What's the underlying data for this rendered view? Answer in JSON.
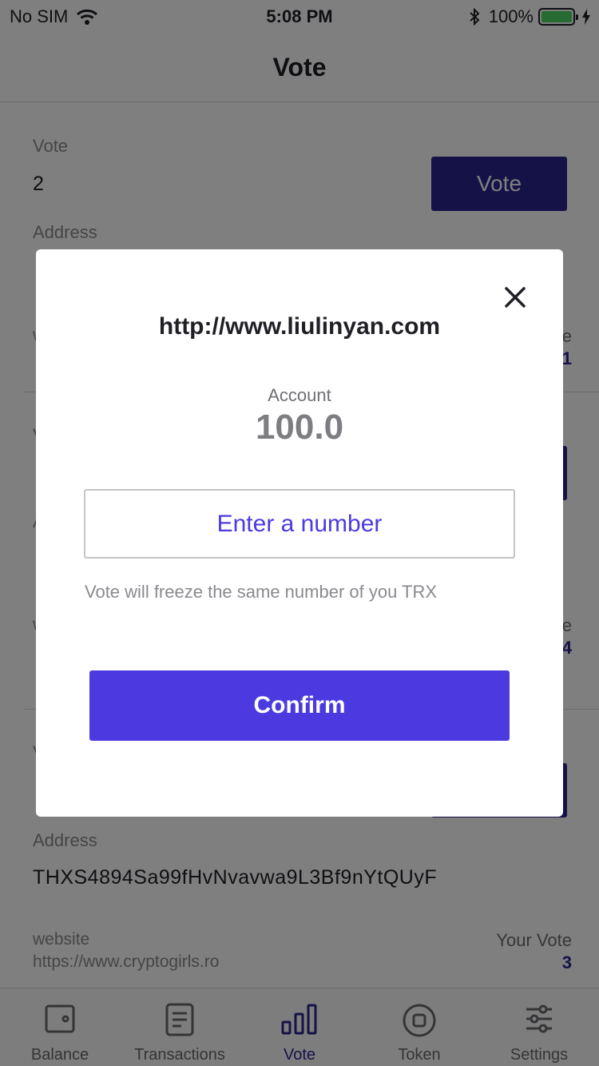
{
  "status_bar": {
    "carrier": "No SIM",
    "time": "5:08 PM",
    "battery": "100%",
    "battery_level": 1.0,
    "battery_color": "#4cd964"
  },
  "nav": {
    "title": "Vote"
  },
  "labels": {
    "vote": "Vote",
    "address": "Address",
    "website": "website",
    "your_vote": "Your Vote",
    "vote_button": "Vote"
  },
  "cards": [
    {
      "vote": "2",
      "address": "",
      "website": "",
      "your_vote": "1"
    },
    {
      "vote": "",
      "address": "",
      "website": "",
      "your_vote": "4"
    },
    {
      "vote": "",
      "address": "THXS4894Sa99fHvNvavwa9L3Bf9nYtQUyF",
      "website": "https://www.cryptogirls.ro",
      "your_vote": "3"
    }
  ],
  "modal": {
    "title": "http://www.liulinyan.com",
    "account_label": "Account",
    "account_value": "100.0",
    "input_placeholder": "Enter a number",
    "input_value": "",
    "hint": "Vote will freeze the same number of you TRX",
    "confirm_label": "Confirm",
    "close_icon": "close-icon"
  },
  "tabs": [
    {
      "label": "Balance",
      "icon": "wallet-icon",
      "active": false
    },
    {
      "label": "Transactions",
      "icon": "document-icon",
      "active": false
    },
    {
      "label": "Vote",
      "icon": "bar-chart-icon",
      "active": true
    },
    {
      "label": "Token",
      "icon": "token-icon",
      "active": false
    },
    {
      "label": "Settings",
      "icon": "sliders-icon",
      "active": false
    }
  ],
  "colors": {
    "accent": "#4a3ae0",
    "vote_button": "#2b2591",
    "active_tab": "#2b2591"
  }
}
